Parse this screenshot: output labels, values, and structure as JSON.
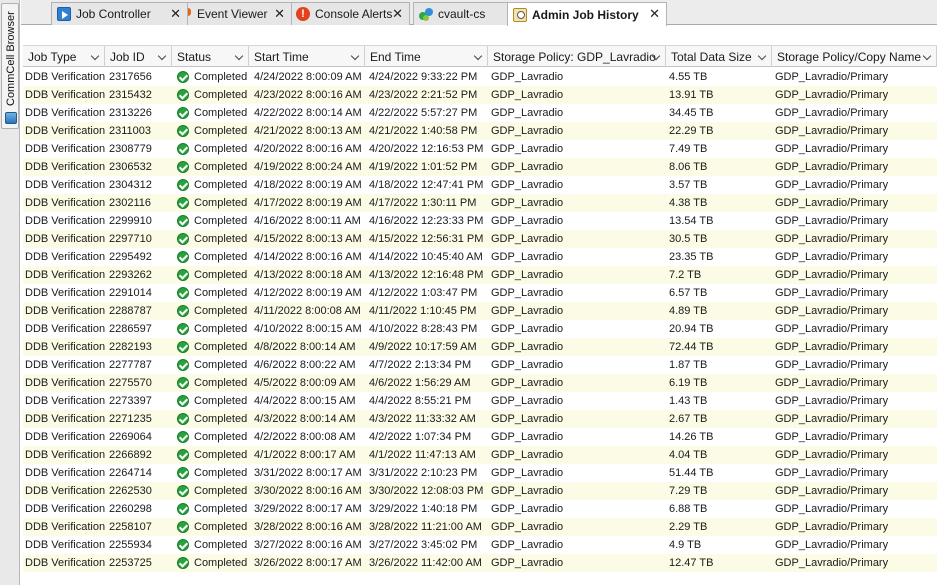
{
  "rail": {
    "label": "CommCell Browser"
  },
  "tabs": [
    {
      "label": "Job Controller",
      "icon": "job-controller-icon",
      "active": false
    },
    {
      "label": "Event Viewer",
      "icon": "event-viewer-flag-icon",
      "active": false
    },
    {
      "label": "Console Alerts",
      "icon": "alert-icon",
      "active": false
    },
    {
      "label": "cvault-cs",
      "icon": "commcell-icon",
      "active": false
    },
    {
      "label": "Admin Job History",
      "icon": "admin-job-history-icon",
      "active": true
    }
  ],
  "tab_close_glyph": "✕",
  "columns": [
    "Job Type",
    "Job ID",
    "Status",
    "Start Time",
    "End Time",
    "Storage Policy: GDP_Lavradio",
    "Total Data Size",
    "Storage Policy/Copy Name"
  ],
  "status_icon": "check-circle-icon",
  "colors": {
    "row_alt": "#fbfbe6",
    "status_green": "#27a33c"
  },
  "rows": [
    [
      "DDB Verification",
      "2317656",
      "Completed",
      "4/24/2022 8:00:09 AM",
      "4/24/2022 9:33:22 PM",
      "GDP_Lavradio",
      "4.55 TB",
      "GDP_Lavradio/Primary"
    ],
    [
      "DDB Verification",
      "2315432",
      "Completed",
      "4/23/2022 8:00:16 AM",
      "4/23/2022 2:21:52 PM",
      "GDP_Lavradio",
      "13.91 TB",
      "GDP_Lavradio/Primary"
    ],
    [
      "DDB Verification",
      "2313226",
      "Completed",
      "4/22/2022 8:00:14 AM",
      "4/22/2022 5:57:27 PM",
      "GDP_Lavradio",
      "34.45 TB",
      "GDP_Lavradio/Primary"
    ],
    [
      "DDB Verification",
      "2311003",
      "Completed",
      "4/21/2022 8:00:13 AM",
      "4/21/2022 1:40:58 PM",
      "GDP_Lavradio",
      "22.29 TB",
      "GDP_Lavradio/Primary"
    ],
    [
      "DDB Verification",
      "2308779",
      "Completed",
      "4/20/2022 8:00:16 AM",
      "4/20/2022 12:16:53 PM",
      "GDP_Lavradio",
      "7.49 TB",
      "GDP_Lavradio/Primary"
    ],
    [
      "DDB Verification",
      "2306532",
      "Completed",
      "4/19/2022 8:00:24 AM",
      "4/19/2022 1:01:52 PM",
      "GDP_Lavradio",
      "8.06 TB",
      "GDP_Lavradio/Primary"
    ],
    [
      "DDB Verification",
      "2304312",
      "Completed",
      "4/18/2022 8:00:19 AM",
      "4/18/2022 12:47:41 PM",
      "GDP_Lavradio",
      "3.57 TB",
      "GDP_Lavradio/Primary"
    ],
    [
      "DDB Verification",
      "2302116",
      "Completed",
      "4/17/2022 8:00:19 AM",
      "4/17/2022 1:30:11 PM",
      "GDP_Lavradio",
      "4.38 TB",
      "GDP_Lavradio/Primary"
    ],
    [
      "DDB Verification",
      "2299910",
      "Completed",
      "4/16/2022 8:00:11 AM",
      "4/16/2022 12:23:33 PM",
      "GDP_Lavradio",
      "13.54 TB",
      "GDP_Lavradio/Primary"
    ],
    [
      "DDB Verification",
      "2297710",
      "Completed",
      "4/15/2022 8:00:13 AM",
      "4/15/2022 12:56:31 PM",
      "GDP_Lavradio",
      "30.5 TB",
      "GDP_Lavradio/Primary"
    ],
    [
      "DDB Verification",
      "2295492",
      "Completed",
      "4/14/2022 8:00:16 AM",
      "4/14/2022 10:45:40 AM",
      "GDP_Lavradio",
      "23.35 TB",
      "GDP_Lavradio/Primary"
    ],
    [
      "DDB Verification",
      "2293262",
      "Completed",
      "4/13/2022 8:00:18 AM",
      "4/13/2022 12:16:48 PM",
      "GDP_Lavradio",
      "7.2 TB",
      "GDP_Lavradio/Primary"
    ],
    [
      "DDB Verification",
      "2291014",
      "Completed",
      "4/12/2022 8:00:19 AM",
      "4/12/2022 1:03:47 PM",
      "GDP_Lavradio",
      "6.57 TB",
      "GDP_Lavradio/Primary"
    ],
    [
      "DDB Verification",
      "2288787",
      "Completed",
      "4/11/2022 8:00:08 AM",
      "4/11/2022 1:10:45 PM",
      "GDP_Lavradio",
      "4.89 TB",
      "GDP_Lavradio/Primary"
    ],
    [
      "DDB Verification",
      "2286597",
      "Completed",
      "4/10/2022 8:00:15 AM",
      "4/10/2022 8:28:43 PM",
      "GDP_Lavradio",
      "20.94 TB",
      "GDP_Lavradio/Primary"
    ],
    [
      "DDB Verification",
      "2282193",
      "Completed",
      "4/8/2022 8:00:14 AM",
      "4/9/2022 10:17:59 AM",
      "GDP_Lavradio",
      "72.44 TB",
      "GDP_Lavradio/Primary"
    ],
    [
      "DDB Verification",
      "2277787",
      "Completed",
      "4/6/2022 8:00:22 AM",
      "4/7/2022 2:13:34 PM",
      "GDP_Lavradio",
      "1.87 TB",
      "GDP_Lavradio/Primary"
    ],
    [
      "DDB Verification",
      "2275570",
      "Completed",
      "4/5/2022 8:00:09 AM",
      "4/6/2022 1:56:29 AM",
      "GDP_Lavradio",
      "6.19 TB",
      "GDP_Lavradio/Primary"
    ],
    [
      "DDB Verification",
      "2273397",
      "Completed",
      "4/4/2022 8:00:15 AM",
      "4/4/2022 8:55:21 PM",
      "GDP_Lavradio",
      "1.43 TB",
      "GDP_Lavradio/Primary"
    ],
    [
      "DDB Verification",
      "2271235",
      "Completed",
      "4/3/2022 8:00:14 AM",
      "4/3/2022 11:33:32 AM",
      "GDP_Lavradio",
      "2.67 TB",
      "GDP_Lavradio/Primary"
    ],
    [
      "DDB Verification",
      "2269064",
      "Completed",
      "4/2/2022 8:00:08 AM",
      "4/2/2022 1:07:34 PM",
      "GDP_Lavradio",
      "14.26 TB",
      "GDP_Lavradio/Primary"
    ],
    [
      "DDB Verification",
      "2266892",
      "Completed",
      "4/1/2022 8:00:17 AM",
      "4/1/2022 11:47:13 AM",
      "GDP_Lavradio",
      "4.04 TB",
      "GDP_Lavradio/Primary"
    ],
    [
      "DDB Verification",
      "2264714",
      "Completed",
      "3/31/2022 8:00:17 AM",
      "3/31/2022 2:10:23 PM",
      "GDP_Lavradio",
      "51.44 TB",
      "GDP_Lavradio/Primary"
    ],
    [
      "DDB Verification",
      "2262530",
      "Completed",
      "3/30/2022 8:00:16 AM",
      "3/30/2022 12:08:03 PM",
      "GDP_Lavradio",
      "7.29 TB",
      "GDP_Lavradio/Primary"
    ],
    [
      "DDB Verification",
      "2260298",
      "Completed",
      "3/29/2022 8:00:17 AM",
      "3/29/2022 1:40:18 PM",
      "GDP_Lavradio",
      "6.88 TB",
      "GDP_Lavradio/Primary"
    ],
    [
      "DDB Verification",
      "2258107",
      "Completed",
      "3/28/2022 8:00:16 AM",
      "3/28/2022 11:21:00 AM",
      "GDP_Lavradio",
      "2.29 TB",
      "GDP_Lavradio/Primary"
    ],
    [
      "DDB Verification",
      "2255934",
      "Completed",
      "3/27/2022 8:00:16 AM",
      "3/27/2022 3:45:02 PM",
      "GDP_Lavradio",
      "4.9 TB",
      "GDP_Lavradio/Primary"
    ],
    [
      "DDB Verification",
      "2253725",
      "Completed",
      "3/26/2022 8:00:17 AM",
      "3/26/2022 11:42:00 AM",
      "GDP_Lavradio",
      "12.47 TB",
      "GDP_Lavradio/Primary"
    ]
  ]
}
